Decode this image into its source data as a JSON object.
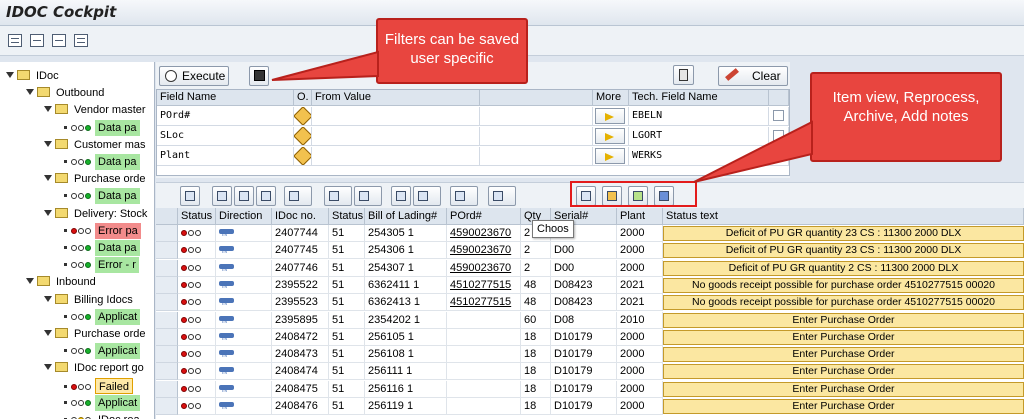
{
  "window": {
    "title": "IDOC Cockpit"
  },
  "tree": [
    {
      "label": "IDoc",
      "type": "folder",
      "level": 0
    },
    {
      "label": "Outbound",
      "type": "folder",
      "level": 1
    },
    {
      "label": "Vendor master",
      "type": "folder",
      "level": 2
    },
    {
      "label": "Data pa",
      "type": "leaf",
      "level": 3,
      "status": "green",
      "highlight": "green"
    },
    {
      "label": "Customer mas",
      "type": "folder",
      "level": 2
    },
    {
      "label": "Data pa",
      "type": "leaf",
      "level": 3,
      "status": "green",
      "highlight": "green"
    },
    {
      "label": "Purchase orde",
      "type": "folder",
      "level": 2
    },
    {
      "label": "Data pa",
      "type": "leaf",
      "level": 3,
      "status": "green",
      "highlight": "green"
    },
    {
      "label": "Delivery: Stock",
      "type": "folder",
      "level": 2
    },
    {
      "label": "Error pa",
      "type": "leaf",
      "level": 3,
      "status": "red",
      "highlight": "red"
    },
    {
      "label": "Data pa",
      "type": "leaf",
      "level": 3,
      "status": "green",
      "highlight": "green"
    },
    {
      "label": "Error - r",
      "type": "leaf",
      "level": 3,
      "status": "green",
      "highlight": "green"
    },
    {
      "label": "Inbound",
      "type": "folder",
      "level": 1
    },
    {
      "label": "Billing Idocs",
      "type": "folder",
      "level": 2
    },
    {
      "label": "Applicat",
      "type": "leaf",
      "level": 3,
      "status": "green",
      "highlight": "green"
    },
    {
      "label": "Purchase orde",
      "type": "folder",
      "level": 2
    },
    {
      "label": "Applicat",
      "type": "leaf",
      "level": 3,
      "status": "green",
      "highlight": "green"
    },
    {
      "label": "IDoc report go",
      "type": "folder",
      "level": 2
    },
    {
      "label": "Failed",
      "type": "leaf",
      "level": 3,
      "status": "red",
      "highlight": "selected"
    },
    {
      "label": "Applicat",
      "type": "leaf",
      "level": 3,
      "status": "green",
      "highlight": "green"
    },
    {
      "label": "IDoc rea",
      "type": "leaf",
      "level": 3,
      "status": "yellow",
      "highlight": "none"
    }
  ],
  "filter": {
    "execute_label": "Execute",
    "clear_label": "Clear",
    "headers": {
      "field_name": "Field Name",
      "op": "O.",
      "from_value": "From Value",
      "more": "More",
      "tech": "Tech. Field Name"
    },
    "rows": [
      {
        "field": "POrd#",
        "tech": "EBELN"
      },
      {
        "field": "SLoc",
        "tech": "LGORT"
      },
      {
        "field": "Plant",
        "tech": "WERKS"
      }
    ]
  },
  "grid": {
    "headers": [
      "Status",
      "Direction",
      "IDoc no.",
      "Status",
      "Bill of Lading#",
      "POrd#",
      "Qty",
      "Serial#",
      "Plant",
      "Status text"
    ],
    "rows": [
      {
        "status": "red",
        "idoc": "2407744",
        "st": "51",
        "bol": "254305 1",
        "pord": "4590023670",
        "qty": "2",
        "serial": "D00",
        "plant": "2000",
        "text": "Deficit of PU GR quantity 23 CS : 11300 2000 DLX"
      },
      {
        "status": "red",
        "idoc": "2407745",
        "st": "51",
        "bol": "254306 1",
        "pord": "4590023670",
        "qty": "2",
        "serial": "D00",
        "plant": "2000",
        "text": "Deficit of PU GR quantity 23 CS : 11300 2000 DLX"
      },
      {
        "status": "red",
        "idoc": "2407746",
        "st": "51",
        "bol": "254307 1",
        "pord": "4590023670",
        "qty": "2",
        "serial": "D00",
        "plant": "2000",
        "text": "Deficit of PU GR quantity 2 CS : 11300 2000 DLX"
      },
      {
        "status": "red",
        "idoc": "2395522",
        "st": "51",
        "bol": "6362411 1",
        "pord": "4510277515",
        "qty": "48",
        "serial": "D08423",
        "plant": "2021",
        "text": "No goods receipt possible for purchase order 4510277515 00020"
      },
      {
        "status": "red",
        "idoc": "2395523",
        "st": "51",
        "bol": "6362413 1",
        "pord": "4510277515",
        "qty": "48",
        "serial": "D08423",
        "plant": "2021",
        "text": "No goods receipt possible for purchase order 4510277515 00020"
      },
      {
        "status": "red",
        "idoc": "2395895",
        "st": "51",
        "bol": "2354202 1",
        "pord": "",
        "qty": "60",
        "serial": "D08",
        "plant": "2010",
        "text": "Enter Purchase Order"
      },
      {
        "status": "red",
        "idoc": "2408472",
        "st": "51",
        "bol": "256105 1",
        "pord": "",
        "qty": "18",
        "serial": "D10179",
        "plant": "2000",
        "text": "Enter Purchase Order"
      },
      {
        "status": "red",
        "idoc": "2408473",
        "st": "51",
        "bol": "256108 1",
        "pord": "",
        "qty": "18",
        "serial": "D10179",
        "plant": "2000",
        "text": "Enter Purchase Order"
      },
      {
        "status": "red",
        "idoc": "2408474",
        "st": "51",
        "bol": "256111 1",
        "pord": "",
        "qty": "18",
        "serial": "D10179",
        "plant": "2000",
        "text": "Enter Purchase Order"
      },
      {
        "status": "red",
        "idoc": "2408475",
        "st": "51",
        "bol": "256116 1",
        "pord": "",
        "qty": "18",
        "serial": "D10179",
        "plant": "2000",
        "text": "Enter Purchase Order"
      },
      {
        "status": "red",
        "idoc": "2408476",
        "st": "51",
        "bol": "256119 1",
        "pord": "",
        "qty": "18",
        "serial": "D10179",
        "plant": "2000",
        "text": "Enter Purchase Order"
      }
    ]
  },
  "tooltip": "Choos",
  "callouts": {
    "filters": "Filters can be saved user specific",
    "actions": "Item view, Reprocess, Archive, Add notes"
  }
}
